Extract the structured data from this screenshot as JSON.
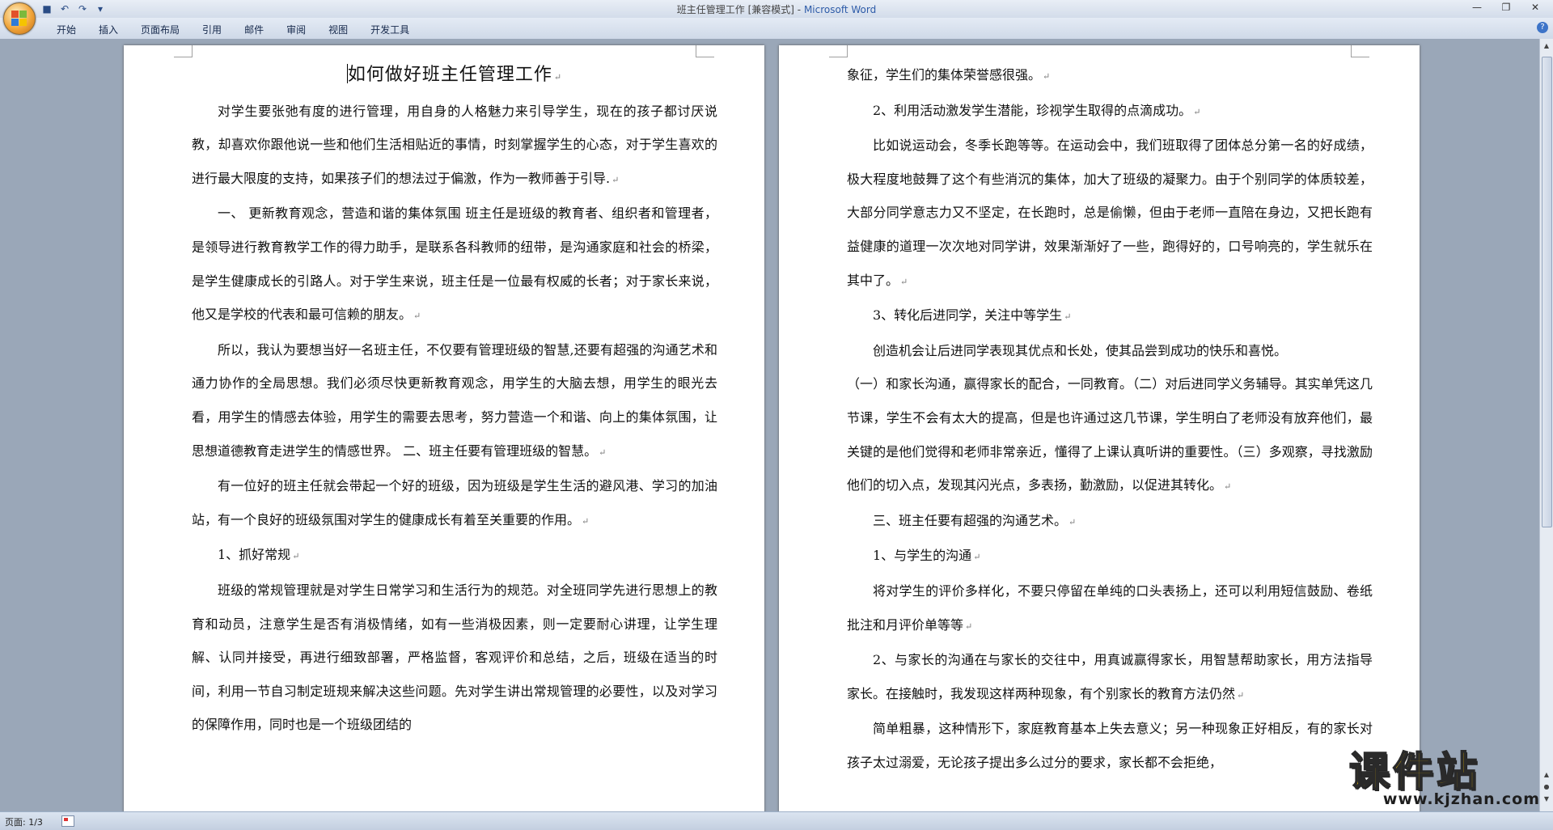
{
  "window": {
    "title": "班主任管理工作 [兼容模式]",
    "title_sep": " - ",
    "app_name": "Microsoft Word"
  },
  "quick_access": [
    "save-icon",
    "undo-icon",
    "redo-icon",
    "customize-icon"
  ],
  "ribbon": {
    "tabs": [
      "开始",
      "插入",
      "页面布局",
      "引用",
      "邮件",
      "审阅",
      "视图",
      "开发工具"
    ]
  },
  "document": {
    "title": "如何做好班主任管理工作",
    "page1": [
      "对学生要张弛有度的进行管理，用自身的人格魅力来引导学生，现在的孩子都讨厌说教，却喜欢你跟他说一些和他们生活相贴近的事情，时刻掌握学生的心态，对于学生喜欢的进行最大限度的支持，如果孩子们的想法过于偏激，作为一教师善于引导.",
      "一、 更新教育观念，营造和谐的集体氛围 班主任是班级的教育者、组织者和管理者，是领导进行教育教学工作的得力助手，是联系各科教师的纽带，是沟通家庭和社会的桥梁，是学生健康成长的引路人。对于学生来说，班主任是一位最有权威的长者；对于家长来说，他又是学校的代表和最可信赖的朋友。",
      "所以，我认为要想当好一名班主任，不仅要有管理班级的智慧,还要有超强的沟通艺术和通力协作的全局思想。我们必须尽快更新教育观念，用学生的大脑去想，用学生的眼光去看，用学生的情感去体验，用学生的需要去思考，努力营造一个和谐、向上的集体氛围，让思想道德教育走进学生的情感世界。 二、班主任要有管理班级的智慧。",
      "有一位好的班主任就会带起一个好的班级，因为班级是学生生活的避风港、学习的加油站，有一个良好的班级氛围对学生的健康成长有着至关重要的作用。",
      "1、抓好常规",
      "班级的常规管理就是对学生日常学习和生活行为的规范。对全班同学先进行思想上的教育和动员，注意学生是否有消极情绪，如有一些消极因素，则一定要耐心讲理，让学生理解、认同并接受，再进行细致部署，严格监督，客观评价和总结，之后，班级在适当的时间，利用一节自习制定班规来解决这些问题。先对学生讲出常规管理的必要性，以及对学习的保障作用，同时也是一个班级团结的"
    ],
    "page2_first": "象征，学生们的集体荣誉感很强。",
    "page2": [
      "2、利用活动激发学生潜能，珍视学生取得的点滴成功。",
      "比如说运动会，冬季长跑等等。在运动会中，我们班取得了团体总分第一名的好成绩，极大程度地鼓舞了这个有些消沉的集体，加大了班级的凝聚力。由于个别同学的体质较差，大部分同学意志力又不坚定，在长跑时，总是偷懒，但由于老师一直陪在身边，又把长跑有益健康的道理一次次地对同学讲，效果渐渐好了一些，跑得好的，口号响亮的，学生就乐在其中了。",
      "3、转化后进同学，关注中等学生",
      "创造机会让后进同学表现其优点和长处，使其品尝到成功的快乐和喜悦。"
    ],
    "page2_noindent": "（一）和家长沟通，赢得家长的配合，一同教育。（二）对后进同学义务辅导。其实单凭这几节课，学生不会有太大的提高，但是也许通过这几节课，学生明白了老师没有放弃他们，最关键的是他们觉得和老师非常亲近，懂得了上课认真听讲的重要性。（三）多观察，寻找激励他们的切入点，发现其闪光点，多表扬，勤激励，以促进其转化。",
    "page2_rest": [
      "三、班主任要有超强的沟通艺术。",
      "1、与学生的沟通",
      "将对学生的评价多样化，不要只停留在单纯的口头表扬上，还可以利用短信鼓励、卷纸批注和月评价单等等",
      "2、与家长的沟通在与家长的交往中，用真诚赢得家长，用智慧帮助家长，用方法指导家长。在接触时，我发现这样两种现象，有个别家长的教育方法仍然",
      "简单粗暴，这种情形下，家庭教育基本上失去意义；另一种现象正好相反，有的家长对孩子太过溺爱，无论孩子提出多么过分的要求，家长都不会拒绝，"
    ]
  },
  "status_bar": {
    "page_indicator": "页面: 1/3"
  },
  "watermark": {
    "brand": "课件站",
    "url": "www.kjzhan.com"
  },
  "colors": {
    "title_app": "#2d5ba8",
    "watermark_fill": "#f7c400",
    "workspace": "#9aa7b8"
  }
}
